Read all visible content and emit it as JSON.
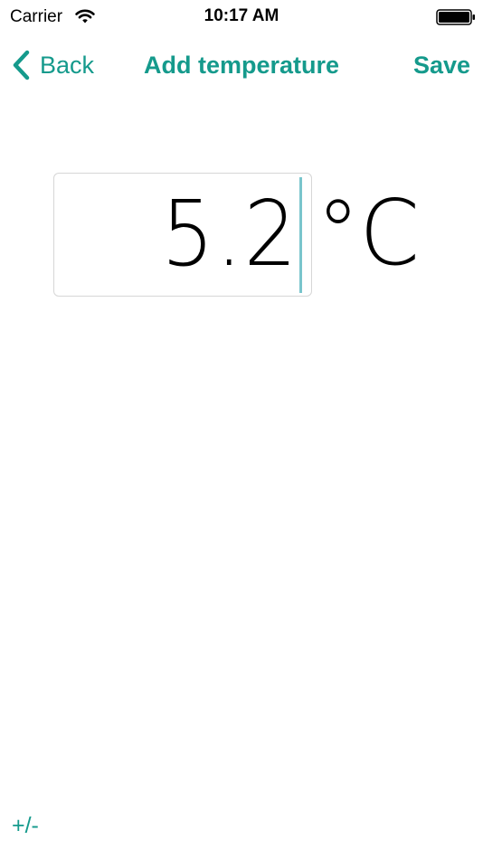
{
  "status_bar": {
    "carrier": "Carrier",
    "time": "10:17 AM",
    "wifi_icon": "wifi-icon",
    "battery_icon": "battery-icon"
  },
  "nav": {
    "back_label": "Back",
    "title": "Add temperature",
    "save_label": "Save",
    "back_icon": "chevron-left-icon"
  },
  "entry": {
    "value": "5.2",
    "unit": "°C"
  },
  "toolbar": {
    "sign_toggle_label": "+/-"
  },
  "colors": {
    "accent": "#159a8c",
    "cursor": "#79c5cc",
    "field_border": "#d6d6d6"
  }
}
